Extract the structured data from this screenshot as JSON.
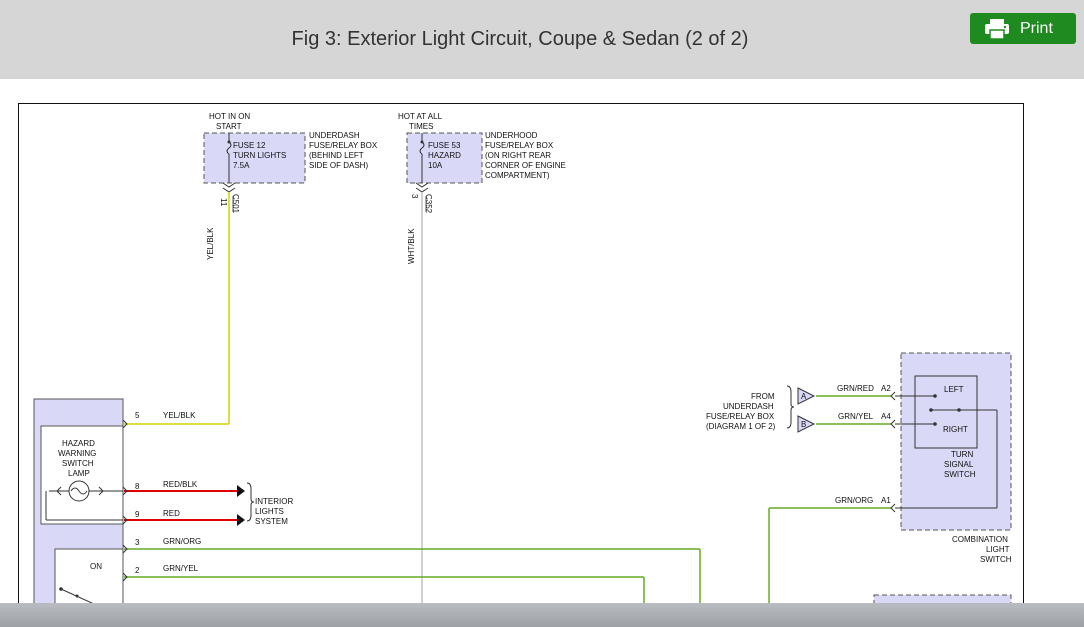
{
  "header": {
    "title": "Fig 3: Exterior Light Circuit, Coupe & Sedan (2 of 2)",
    "print_label": "Print"
  },
  "colors": {
    "header_bg": "#d6d6d6",
    "print_bg": "#1f8a1f",
    "wire_yellow": "#d4d400",
    "wire_gray": "#c0c0c0",
    "wire_red": "#e00000",
    "wire_green": "#66aa22",
    "component_fill": "#d9d9f7"
  },
  "icons": [
    "printer-icon",
    "bulb-icon",
    "switch-icon",
    "connector-arrow-icon"
  ],
  "diagram": {
    "fuse1": {
      "hot_label_1": "HOT IN ON",
      "hot_label_2": "START",
      "fuse_line1": "FUSE 12",
      "fuse_line2": "TURN LIGHTS",
      "fuse_line3": "7.5A",
      "box_line1": "UNDERDASH",
      "box_line2": "FUSE/RELAY BOX",
      "box_line3": "(BEHIND LEFT",
      "box_line4": "SIDE OF DASH)",
      "pin": "11",
      "connector": "C501",
      "wire": "YEL/BLK"
    },
    "fuse2": {
      "hot_label_1": "HOT AT ALL",
      "hot_label_2": "TIMES",
      "fuse_line1": "FUSE 53",
      "fuse_line2": "HAZARD",
      "fuse_line3": "10A",
      "box_line1": "UNDERHOOD",
      "box_line2": "FUSE/RELAY BOX",
      "box_line3": "(ON RIGHT REAR",
      "box_line4": "CORNER OF ENGINE",
      "box_line5": "COMPARTMENT)",
      "pin": "3",
      "connector": "C352",
      "wire": "WHT/BLK"
    },
    "hazard_switch": {
      "lamp_line1": "HAZARD",
      "lamp_line2": "WARNING",
      "lamp_line3": "SWITCH",
      "lamp_line4": "LAMP",
      "on_label": "ON",
      "pins": [
        "5",
        "8",
        "9",
        "3",
        "2"
      ],
      "wires": [
        "YEL/BLK",
        "RED/BLK",
        "RED",
        "GRN/ORG",
        "GRN/YEL"
      ]
    },
    "interior": {
      "line1": "INTERIOR",
      "line2": "LIGHTS",
      "line3": "SYSTEM"
    },
    "from_box": {
      "line1": "FROM",
      "line2": "UNDERDASH",
      "line3": "FUSE/RELAY BOX",
      "line4": "(DIAGRAM 1 OF 2)",
      "conn_a": "A",
      "conn_b": "B"
    },
    "combination_switch": {
      "wire_a2": "GRN/RED",
      "pin_a2": "A2",
      "wire_a4": "GRN/YEL",
      "pin_a4": "A4",
      "wire_a1": "GRN/ORG",
      "pin_a1": "A1",
      "left_label": "LEFT",
      "right_label": "RIGHT",
      "turn_line1": "TURN",
      "turn_line2": "SIGNAL",
      "turn_line3": "SWITCH",
      "combo_line1": "COMBINATION",
      "combo_line2": "LIGHT",
      "combo_line3": "SWITCH"
    }
  }
}
